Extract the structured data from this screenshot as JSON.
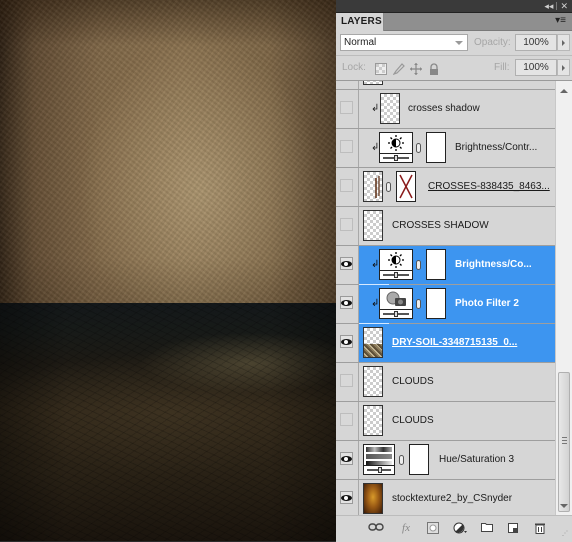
{
  "canvas": {
    "description": "Photo manipulation: grungy brown textured sky over dark cracked dry soil",
    "sky_color": "#7c6446",
    "ground_color": "#2a2216"
  },
  "panel": {
    "tab_label": "LAYERS",
    "title_controls": {
      "collapse": "◂◂",
      "close": "✕"
    },
    "menu_icon": "▾≡",
    "blend_mode": "Normal",
    "opacity_label": "Opacity:",
    "opacity_value": "100%",
    "lock_label": "Lock:",
    "fill_label": "Fill:",
    "fill_value": "100%",
    "selection_color": "#3d95f0"
  },
  "layers": [
    {
      "name": "crosses shadow",
      "visible": false,
      "selected": false,
      "clipped": true,
      "type": "pixel",
      "underlined": false
    },
    {
      "name": "Brightness/Contr...",
      "visible": false,
      "selected": false,
      "clipped": true,
      "type": "adjustment-brightness",
      "underlined": false
    },
    {
      "name": "CROSSES-838435_8463...",
      "visible": false,
      "selected": false,
      "clipped": false,
      "type": "pixel-mask",
      "underlined": true
    },
    {
      "name": "CROSSES SHADOW",
      "visible": false,
      "selected": false,
      "clipped": false,
      "type": "pixel",
      "underlined": false
    },
    {
      "name": "Brightness/Co...",
      "visible": true,
      "selected": true,
      "clipped": true,
      "type": "adjustment-brightness",
      "underlined": false
    },
    {
      "name": "Photo Filter 2",
      "visible": true,
      "selected": true,
      "clipped": true,
      "type": "adjustment-photofilter",
      "underlined": false
    },
    {
      "name": "DRY-SOIL-3348715135_0...",
      "visible": true,
      "selected": true,
      "clipped": false,
      "type": "pixel-soil",
      "underlined": true
    },
    {
      "name": "CLOUDS",
      "visible": false,
      "selected": false,
      "clipped": false,
      "type": "pixel",
      "underlined": false
    },
    {
      "name": "CLOUDS",
      "visible": false,
      "selected": false,
      "clipped": false,
      "type": "pixel",
      "underlined": false
    },
    {
      "name": "Hue/Saturation 3",
      "visible": true,
      "selected": false,
      "clipped": false,
      "type": "adjustment-huesat",
      "underlined": false
    },
    {
      "name": "stocktexture2_by_CSnyder",
      "visible": true,
      "selected": false,
      "clipped": false,
      "type": "pixel-texture",
      "underlined": false
    }
  ],
  "bottom_toolbar": [
    {
      "name": "link-layers",
      "glyph": "⚭"
    },
    {
      "name": "add-layer-style",
      "glyph": "fx"
    },
    {
      "name": "add-layer-mask",
      "glyph": "◙"
    },
    {
      "name": "new-adjustment-layer",
      "glyph": "◐"
    },
    {
      "name": "new-group",
      "glyph": "▭"
    },
    {
      "name": "new-layer",
      "glyph": "◳"
    },
    {
      "name": "delete-layer",
      "glyph": "🗑"
    }
  ]
}
